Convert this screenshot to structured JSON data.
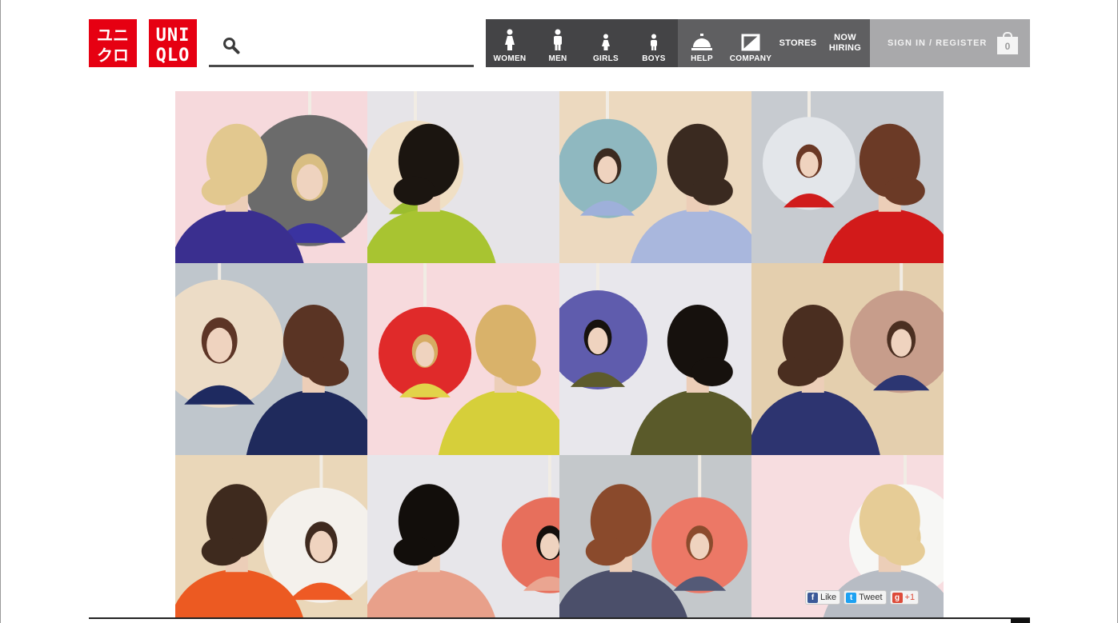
{
  "logo_ja": {
    "lines": [
      "ユニ",
      "クロ"
    ]
  },
  "logo_en": {
    "lines": [
      "UNI",
      "QLO"
    ]
  },
  "search": {
    "value": "",
    "placeholder": ""
  },
  "nav": {
    "women": "WOMEN",
    "men": "MEN",
    "girls": "GIRLS",
    "boys": "BOYS",
    "help": "HELP",
    "company": "COMPANY",
    "stores": "STORES",
    "now_hiring_1": "NOW",
    "now_hiring_2": "HIRING"
  },
  "account": {
    "signin": "SIGN IN / REGISTER",
    "cart_count": "0"
  },
  "social": {
    "like": "Like",
    "tweet": "Tweet",
    "plusone": "+1"
  },
  "colors": {
    "brand_red": "#e60012",
    "nav_dark": "#444446",
    "nav_mid": "#5f5f61",
    "account_gray": "#a9a9ab"
  },
  "tiles": [
    {
      "bg": "#f6d9dc",
      "circle": "#6b6b6b",
      "hair": "#e2c88f",
      "shirt": "#3a2f8f",
      "hair2": "#d8bd82",
      "shirt2": "#3a33a0"
    },
    {
      "bg": "#e6e4e8",
      "circle": "#f0dfc4",
      "hair": "#1b1510",
      "shirt": "#a8c431",
      "hair2": "#1e1712",
      "shirt2": "#9bbd2e"
    },
    {
      "bg": "#ecd9bf",
      "circle": "#8fb8c0",
      "hair": "#3a2a20",
      "shirt": "#a9b7dd",
      "hair2": "#3b2a20",
      "shirt2": "#9eb0da"
    },
    {
      "bg": "#c7cbd0",
      "circle": "#e3e6ea",
      "hair": "#6b3a26",
      "shirt": "#d21a1a",
      "hair2": "#6a3825",
      "shirt2": "#d01c1c"
    },
    {
      "bg": "#bfc6cc",
      "circle": "#ecdcc6",
      "hair": "#5a3424",
      "shirt": "#1f2a5c",
      "hair2": "#5d3526",
      "shirt2": "#1e2a60"
    },
    {
      "bg": "#f7dadd",
      "circle": "#e02a2a",
      "hair": "#d9b26a",
      "shirt": "#d6cf3a",
      "hair2": "#d6ac63",
      "shirt2": "#e2d34a"
    },
    {
      "bg": "#e8e7ec",
      "circle": "#5f5cad",
      "hair": "#16110d",
      "shirt": "#5a5a2a",
      "hair2": "#17120e",
      "shirt2": "#5d5b2c"
    },
    {
      "bg": "#e4cfae",
      "circle": "#c79d8b",
      "hair": "#4a2e20",
      "shirt": "#2d3470",
      "hair2": "#4b2f21",
      "shirt2": "#2c3672"
    },
    {
      "bg": "#ead7b9",
      "circle": "#f4f1ec",
      "hair": "#3e2a1e",
      "shirt": "#ec5a22",
      "hair2": "#3f2a1f",
      "shirt2": "#ee5a24"
    },
    {
      "bg": "#e7e6ea",
      "circle": "#e76f5c",
      "hair": "#120e0b",
      "shirt": "#e8a08a",
      "hair2": "#140f0c",
      "shirt2": "#eaa591"
    },
    {
      "bg": "#c4c8cb",
      "circle": "#ec7866",
      "hair": "#8a4a2c",
      "shirt": "#4b4f6a",
      "hair2": "#8b4b2d",
      "shirt2": "#545a77"
    },
    {
      "bg": "#f7dde0",
      "circle": "#f7f7f5",
      "hair": "#e6cc96",
      "shirt": "#b7bcc4",
      "hair2": "#e4c991",
      "shirt2": "#8aa0b6"
    }
  ]
}
